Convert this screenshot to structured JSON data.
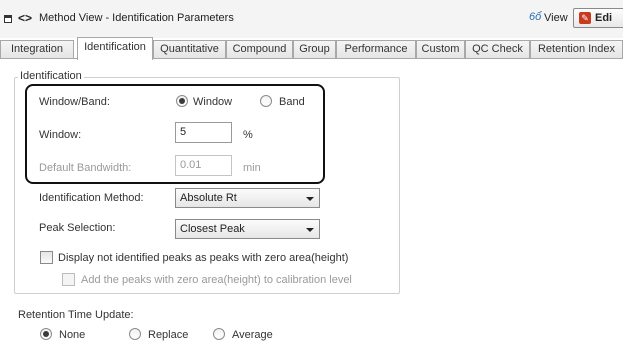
{
  "window": {
    "title": "Method View - Identification Parameters",
    "view_label": "View",
    "edit_label": "Edi"
  },
  "tabs": [
    {
      "label": "Integration"
    },
    {
      "label": "Identification"
    },
    {
      "label": "Quantitative"
    },
    {
      "label": "Compound"
    },
    {
      "label": "Group"
    },
    {
      "label": "Performance"
    },
    {
      "label": "Custom"
    },
    {
      "label": "QC Check"
    },
    {
      "label": "Retention Index"
    }
  ],
  "active_tab": "Identification",
  "identification": {
    "group_label": "Identification",
    "window_band_label": "Window/Band:",
    "window_option": "Window",
    "band_option": "Band",
    "selected_mode": "Window",
    "window_label": "Window:",
    "window_value": "5",
    "window_unit": "%",
    "default_bandwidth_label": "Default Bandwidth:",
    "default_bandwidth_value": "0.01",
    "default_bandwidth_unit": "min",
    "method_label": "Identification Method:",
    "method_value": "Absolute Rt",
    "peak_selection_label": "Peak Selection:",
    "peak_selection_value": "Closest Peak",
    "display_not_identified_label": "Display not identified peaks as peaks with zero area(height)",
    "add_peaks_label": "Add the peaks with zero area(height) to calibration level"
  },
  "retention_time_update": {
    "label": "Retention Time Update:",
    "options": [
      "None",
      "Replace",
      "Average"
    ],
    "selected": "None"
  },
  "colors": {
    "accent_blue": "#2a6fb5",
    "edit_icon_red": "#c73a1c"
  }
}
